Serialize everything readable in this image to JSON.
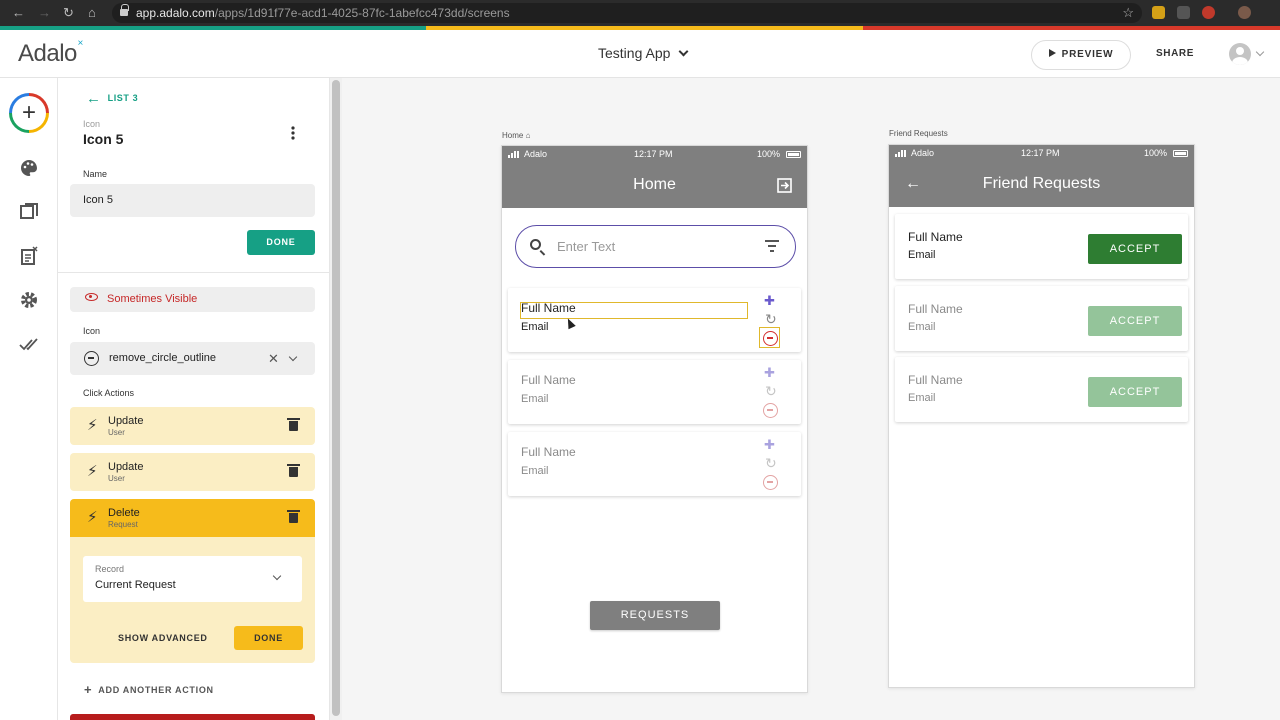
{
  "browser": {
    "url_domain": "app.adalo.com",
    "url_path": "/apps/1d91f77e-acd1-4025-87fc-1abefcc473dd/screens"
  },
  "header": {
    "logo": "Adalo",
    "app_name": "Testing App",
    "preview_label": "PREVIEW",
    "share_label": "SHARE"
  },
  "panel": {
    "back_label": "LIST 3",
    "component_type": "Icon",
    "component_name": "Icon 5",
    "name_label": "Name",
    "name_value": "Icon  5",
    "done_label": "DONE",
    "visibility_label": "Sometimes Visible",
    "icon_label": "Icon",
    "icon_value": "remove_circle_outline",
    "click_actions_label": "Click Actions",
    "actions": [
      {
        "title": "Update",
        "subtitle": "User"
      },
      {
        "title": "Update",
        "subtitle": "User"
      },
      {
        "title": "Delete",
        "subtitle": "Request"
      }
    ],
    "record_label": "Record",
    "record_value": "Current Request",
    "show_advanced_label": "SHOW ADVANCED",
    "action_done_label": "DONE",
    "add_action_label": "ADD ANOTHER ACTION"
  },
  "home_screen": {
    "screen_label": "Home",
    "carrier": "Adalo",
    "time": "12:17 PM",
    "battery": "100%",
    "title": "Home",
    "search_placeholder": "Enter Text",
    "items": [
      {
        "name": "Full Name",
        "email": "Email"
      },
      {
        "name": "Full Name",
        "email": "Email"
      },
      {
        "name": "Full Name",
        "email": "Email"
      }
    ],
    "requests_button": "REQUESTS"
  },
  "friend_screen": {
    "screen_label": "Friend Requests",
    "carrier": "Adalo",
    "time": "12:17 PM",
    "battery": "100%",
    "title": "Friend Requests",
    "items": [
      {
        "name": "Full Name",
        "email": "Email",
        "button": "ACCEPT"
      },
      {
        "name": "Full Name",
        "email": "Email",
        "button": "ACCEPT"
      },
      {
        "name": "Full Name",
        "email": "Email",
        "button": "ACCEPT"
      }
    ]
  },
  "colors": {
    "accent_teal": "#16a085",
    "action_yellow": "#f6bb1b",
    "appbar_gray": "#7f7f7f",
    "accept_green": "#2e7d32",
    "visibility_red": "#c62828"
  }
}
